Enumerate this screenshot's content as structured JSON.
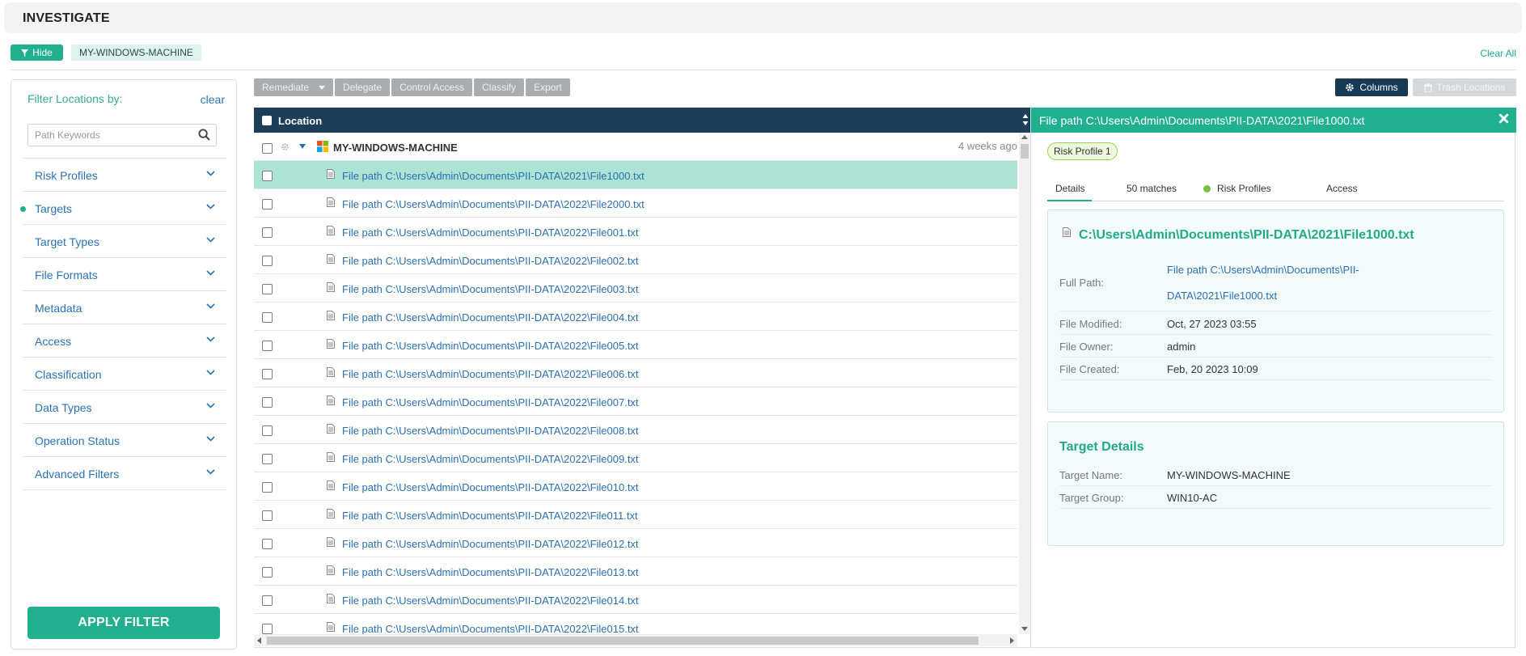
{
  "header": {
    "title": "INVESTIGATE"
  },
  "filterbar": {
    "hide_label": "Hide",
    "chip_label": "MY-WINDOWS-MACHINE",
    "clear_all_label": "Clear All"
  },
  "left_panel": {
    "title": "Filter Locations by:",
    "clear_label": "clear",
    "search_placeholder": "Path Keywords",
    "items": [
      {
        "label": "Risk Profiles"
      },
      {
        "label": "Targets"
      },
      {
        "label": "Target Types"
      },
      {
        "label": "File Formats"
      },
      {
        "label": "Metadata"
      },
      {
        "label": "Access"
      },
      {
        "label": "Classification"
      },
      {
        "label": "Data Types"
      },
      {
        "label": "Operation Status"
      },
      {
        "label": "Advanced Filters"
      }
    ],
    "apply_label": "APPLY FILTER",
    "accent_color": "#21b08f"
  },
  "toolbar": {
    "remediate": "Remediate",
    "delegate": "Delegate",
    "control_access": "Control Access",
    "classify": "Classify",
    "export": "Export",
    "columns": "Columns",
    "trash_locations": "Trash Locations"
  },
  "grid": {
    "header_label": "Location",
    "machine": {
      "name": "MY-WINDOWS-MACHINE",
      "modified": "4 weeks ago"
    },
    "rows": [
      "File path C:\\Users\\Admin\\Documents\\PII-DATA\\2021\\File1000.txt",
      "File path C:\\Users\\Admin\\Documents\\PII-DATA\\2022\\File2000.txt",
      "File path C:\\Users\\Admin\\Documents\\PII-DATA\\2022\\File001.txt",
      "File path C:\\Users\\Admin\\Documents\\PII-DATA\\2022\\File002.txt",
      "File path C:\\Users\\Admin\\Documents\\PII-DATA\\2022\\File003.txt",
      "File path C:\\Users\\Admin\\Documents\\PII-DATA\\2022\\File004.txt",
      "File path C:\\Users\\Admin\\Documents\\PII-DATA\\2022\\File005.txt",
      "File path C:\\Users\\Admin\\Documents\\PII-DATA\\2022\\File006.txt",
      "File path C:\\Users\\Admin\\Documents\\PII-DATA\\2022\\File007.txt",
      "File path C:\\Users\\Admin\\Documents\\PII-DATA\\2022\\File008.txt",
      "File path C:\\Users\\Admin\\Documents\\PII-DATA\\2022\\File009.txt",
      "File path C:\\Users\\Admin\\Documents\\PII-DATA\\2022\\File010.txt",
      "File path C:\\Users\\Admin\\Documents\\PII-DATA\\2022\\File011.txt",
      "File path C:\\Users\\Admin\\Documents\\PII-DATA\\2022\\File012.txt",
      "File path C:\\Users\\Admin\\Documents\\PII-DATA\\2022\\File013.txt",
      "File path C:\\Users\\Admin\\Documents\\PII-DATA\\2022\\File014.txt",
      "File path C:\\Users\\Admin\\Documents\\PII-DATA\\2022\\File015.txt"
    ],
    "header_color": "#1d3e58",
    "selected_row_color": "#ace3d5"
  },
  "detail": {
    "title": "File path C:\\Users\\Admin\\Documents\\PII-DATA\\2021\\File1000.txt",
    "risk_badge": "Risk Profile 1",
    "tabs": [
      "Details",
      "50 matches",
      "Risk Profiles",
      "Access"
    ],
    "file_card": {
      "title": "C:\\Users\\Admin\\Documents\\PII-DATA\\2021\\File1000.txt",
      "full_path_label": "Full Path:",
      "full_path_line1": "File path C:\\Users\\Admin\\Documents\\PII-",
      "full_path_line2": "DATA\\2021\\File1000.txt",
      "modified_label": "File Modified:",
      "modified_value": "Oct, 27 2023 03:55",
      "owner_label": "File Owner:",
      "owner_value": "admin",
      "created_label": "File Created:",
      "created_value": "Feb, 20 2023 10:09"
    },
    "target_card": {
      "title": "Target Details",
      "name_label": "Target Name:",
      "name_value": "MY-WINDOWS-MACHINE",
      "group_label": "Target Group:",
      "group_value": "WIN10-AC"
    }
  }
}
